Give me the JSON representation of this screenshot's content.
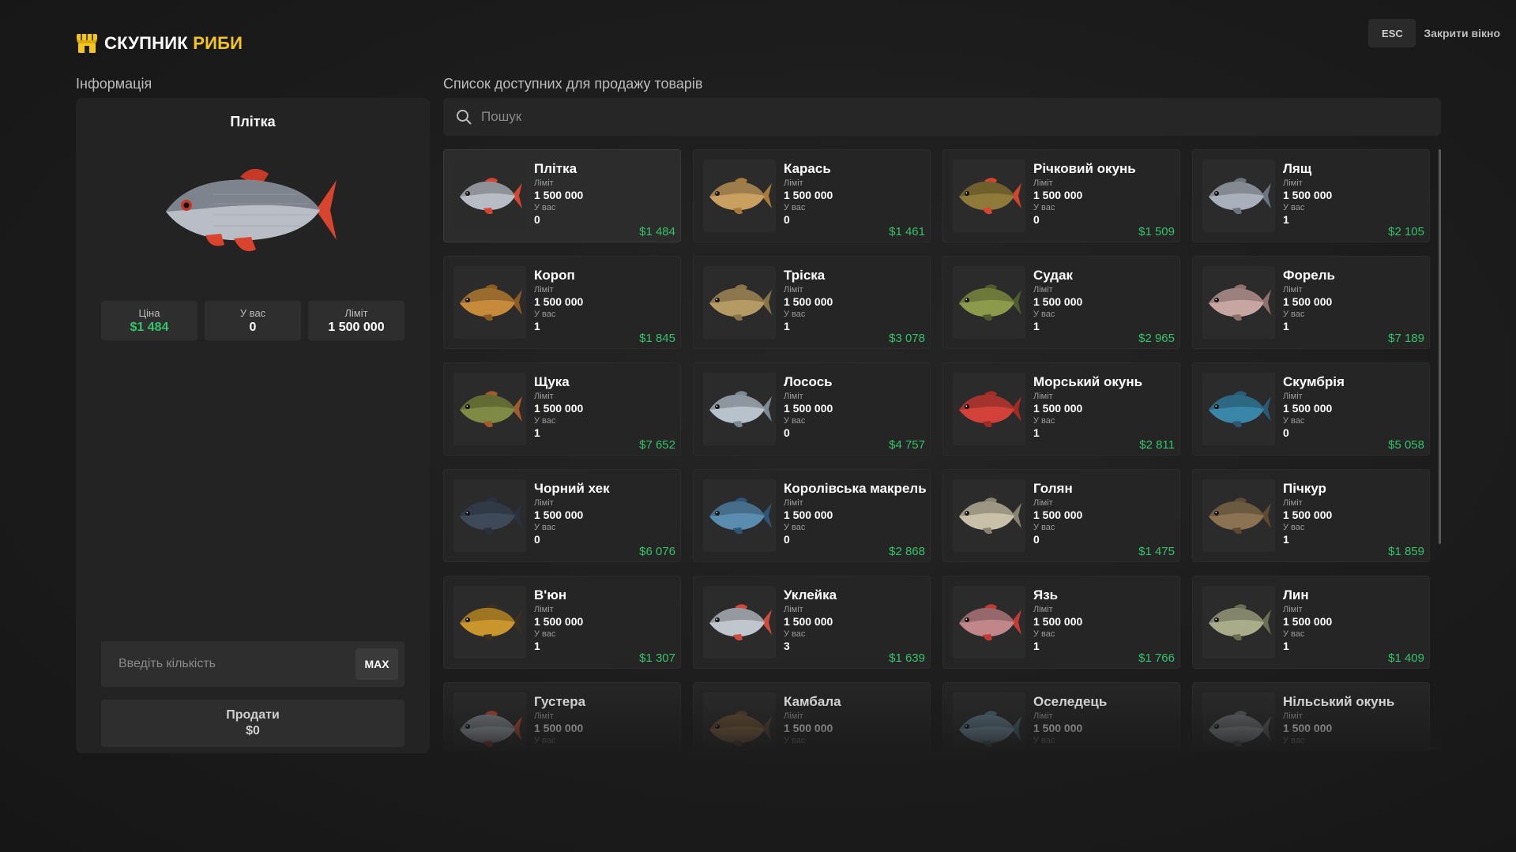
{
  "header": {
    "title_main": "СКУПНИК",
    "title_accent": "РИБИ",
    "logo_icon": "shop-icon",
    "esc_label": "ESC",
    "close_label": "Закрити вікно"
  },
  "colors": {
    "accent": "#f5c518",
    "price": "#34c26a",
    "background": "#1b1b1b",
    "panel": "#232323",
    "card": "#252525"
  },
  "info": {
    "section_title": "Інформація",
    "name": "Плітка",
    "fish_image": "roach-fish-image",
    "stats": {
      "price_label": "Ціна",
      "price_value": "$1 484",
      "have_label": "У вас",
      "have_value": "0",
      "limit_label": "Ліміт",
      "limit_value": "1 500 000"
    },
    "qty_placeholder": "Введіть кількість",
    "max_label": "MAX",
    "sell_label": "Продати",
    "sell_amount": "$0"
  },
  "list": {
    "section_title": "Список доступних для продажу товарів",
    "search_placeholder": "Пошук",
    "search_icon": "search-icon",
    "limit_label": "Ліміт",
    "have_label": "У вас",
    "items": [
      {
        "name": "Плітка",
        "limit": "1 500 000",
        "have": "0",
        "price": "$1 484",
        "body": "#b8bcc4",
        "fin": "#d8442e",
        "selected": true
      },
      {
        "name": "Карась",
        "limit": "1 500 000",
        "have": "0",
        "price": "$1 461",
        "body": "#c9a060",
        "fin": "#a9793a"
      },
      {
        "name": "Річковий окунь",
        "limit": "1 500 000",
        "have": "0",
        "price": "$1 509",
        "body": "#8f7a3a",
        "fin": "#d5452e"
      },
      {
        "name": "Лящ",
        "limit": "1 500 000",
        "have": "1",
        "price": "$2 105",
        "body": "#aab0bb",
        "fin": "#6c7480"
      },
      {
        "name": "Короп",
        "limit": "1 500 000",
        "have": "1",
        "price": "$1 845",
        "body": "#c58a3a",
        "fin": "#8e5a22"
      },
      {
        "name": "Тріска",
        "limit": "1 500 000",
        "have": "1",
        "price": "$3 078",
        "body": "#b59a64",
        "fin": "#8a7347"
      },
      {
        "name": "Судак",
        "limit": "1 500 000",
        "have": "1",
        "price": "$2 965",
        "body": "#8c9a4c",
        "fin": "#4f5b2c"
      },
      {
        "name": "Форель",
        "limit": "1 500 000",
        "have": "1",
        "price": "$7 189",
        "body": "#c7a5a0",
        "fin": "#8e6f6a"
      },
      {
        "name": "Щука",
        "limit": "1 500 000",
        "have": "1",
        "price": "$7 652",
        "body": "#7f8a44",
        "fin": "#a45a2a"
      },
      {
        "name": "Лосось",
        "limit": "1 500 000",
        "have": "0",
        "price": "$4 757",
        "body": "#b7c2cc",
        "fin": "#7b8a96"
      },
      {
        "name": "Морський окунь",
        "limit": "1 500 000",
        "have": "1",
        "price": "$2 811",
        "body": "#d2423a",
        "fin": "#a52a24"
      },
      {
        "name": "Скумбрія",
        "limit": "1 500 000",
        "have": "0",
        "price": "$5 058",
        "body": "#3a86a8",
        "fin": "#2a5a74"
      },
      {
        "name": "Чорний хек",
        "limit": "1 500 000",
        "have": "0",
        "price": "$6 076",
        "body": "#3e4a5a",
        "fin": "#283240"
      },
      {
        "name": "Королівська макрель",
        "limit": "1 500 000",
        "have": "0",
        "price": "$2 868",
        "body": "#5a8cb0",
        "fin": "#2e5676"
      },
      {
        "name": "Голян",
        "limit": "1 500 000",
        "have": "0",
        "price": "$1 475",
        "body": "#c8c0a8",
        "fin": "#8a8270"
      },
      {
        "name": "Пічкур",
        "limit": "1 500 000",
        "have": "1",
        "price": "$1 859",
        "body": "#8a7252",
        "fin": "#5c4a34"
      },
      {
        "name": "В'юн",
        "limit": "1 500 000",
        "have": "1",
        "price": "$1 307",
        "body": "#c9962e",
        "fin": "#3a3020"
      },
      {
        "name": "Уклейка",
        "limit": "1 500 000",
        "have": "3",
        "price": "$1 639",
        "body": "#bfc6ce",
        "fin": "#d24a3a"
      },
      {
        "name": "Язь",
        "limit": "1 500 000",
        "have": "1",
        "price": "$1 766",
        "body": "#c0868a",
        "fin": "#c43a30"
      },
      {
        "name": "Лин",
        "limit": "1 500 000",
        "have": "1",
        "price": "$1 409",
        "body": "#a9ac8a",
        "fin": "#6b6e52"
      },
      {
        "name": "Густера",
        "limit": "1 500 000",
        "have": "",
        "price": "",
        "body": "#aab0b8",
        "fin": "#c24a3a"
      },
      {
        "name": "Камбала",
        "limit": "1 500 000",
        "have": "",
        "price": "",
        "body": "#8a6a44",
        "fin": "#5c4630"
      },
      {
        "name": "Оселедець",
        "limit": "1 500 000",
        "have": "",
        "price": "",
        "body": "#7a9aae",
        "fin": "#4e6878"
      },
      {
        "name": "Нільський окунь",
        "limit": "1 500 000",
        "have": "",
        "price": "",
        "body": "#8e9296",
        "fin": "#5e6266"
      }
    ]
  }
}
